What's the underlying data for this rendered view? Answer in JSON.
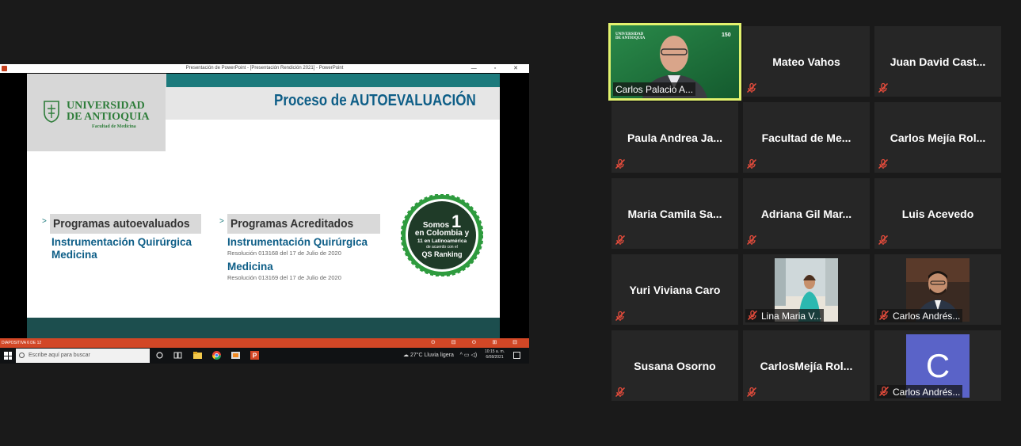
{
  "ppt": {
    "title": "Presentación de PowerPoint - [Presentación Rendición 2021] - PowerPoint",
    "window_controls": "— ▫ ✕",
    "status_text": "DIAPOSITIVA 6 DE 12",
    "status_icons": "⊙ ⊟ ⊙ ⊞ ⊟",
    "slide": {
      "title": "Proceso de AUTOEVALUACIÓN",
      "logo_line1": "UNIVERSIDAD",
      "logo_line2": "DE ANTIOQUIA",
      "logo_line3": "Facultad de Medicina",
      "left_label": "Programas autoevaluados",
      "left_items": [
        "Instrumentación Quirúrgica",
        "Medicina"
      ],
      "right_label": "Programas Acreditados",
      "right_item1": "Instrumentación Quirúrgica",
      "right_res1": "Resolución 013168 del 17 de Julio de 2020",
      "right_item2": "Medicina",
      "right_res2": "Resolución 013169 del 17 de Julio de 2020",
      "badge_line1": "Somos",
      "badge_num": "1",
      "badge_line2": "en Colombia y",
      "badge_line3": "11 en Latinoamérica",
      "badge_line4": "de acuerdo con el",
      "badge_line5": "QS Ranking"
    },
    "chevron": ">"
  },
  "taskbar": {
    "search_placeholder": "Escribe aquí para buscar",
    "weather": "27°C  Lluvia ligera",
    "time": "10:15 a. m.",
    "date": "6/08/2021"
  },
  "participants": [
    {
      "name": "Carlos Palacio A...",
      "video": true,
      "active": true
    },
    {
      "name": "Mateo Vahos"
    },
    {
      "name": "Juan David Cast..."
    },
    {
      "name": "Paula Andrea Ja..."
    },
    {
      "name": "Facultad de Me..."
    },
    {
      "name": "Carlos Mejía Rol..."
    },
    {
      "name": "Maria Camila Sa..."
    },
    {
      "name": "Adriana Gil Mar..."
    },
    {
      "name": "Luis Acevedo"
    },
    {
      "name": "Yuri Viviana Caro"
    },
    {
      "name": "Lina Maria V...",
      "video": true
    },
    {
      "name": "Carlos Andrés...",
      "video": true
    },
    {
      "name": "Susana Osorno"
    },
    {
      "name": "CarlosMejía Rol..."
    },
    {
      "name": "Carlos Andrés...",
      "avatar_letter": "C",
      "avatar_color": "#5a63c8"
    }
  ],
  "colors": {
    "active_border": "#e2f26e",
    "mute_icon": "#e74c3c",
    "tile_bg": "#262626",
    "ppt_status": "#d24726",
    "slide_teal": "#1c7a7c",
    "title_blue": "#0e5e87",
    "logo_green": "#2e7d3a",
    "badge_green": "#2e9b3e"
  }
}
